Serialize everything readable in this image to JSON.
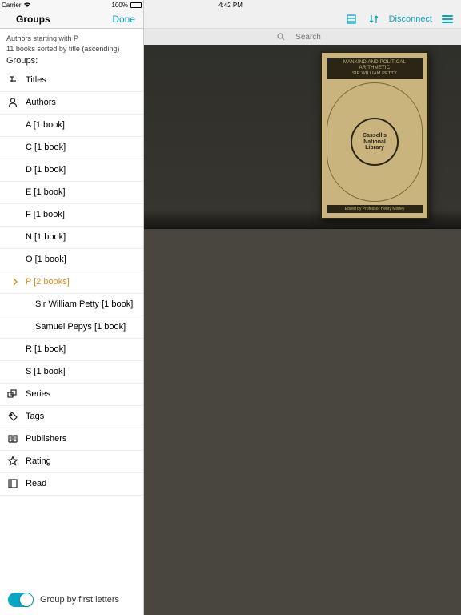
{
  "status": {
    "carrier": "Carrier",
    "time": "4:42 PM",
    "battery": "100%"
  },
  "sidebar": {
    "title": "Groups",
    "done": "Done",
    "filter_line": "Authors starting with P",
    "count_line": "11 books sorted by title (ascending)",
    "groups_label": "Groups:",
    "sections": [
      {
        "label": "Titles",
        "icon": "titles"
      },
      {
        "label": "Authors",
        "icon": "authors"
      }
    ],
    "author_letters": [
      {
        "label": "A [1 book]"
      },
      {
        "label": "C [1 book]"
      },
      {
        "label": "D [1 book]"
      },
      {
        "label": "E [1 book]"
      },
      {
        "label": "F [1 book]"
      },
      {
        "label": "N [1 book]"
      },
      {
        "label": "O [1 book]"
      },
      {
        "label": "P [2 books]",
        "active": true
      },
      {
        "label": "R [1 book]"
      },
      {
        "label": "S [1 book]"
      }
    ],
    "expanded_authors": [
      {
        "label": "Sir William Petty [1 book]"
      },
      {
        "label": "Samuel Pepys [1 book]"
      }
    ],
    "other_sections": [
      {
        "label": "Series",
        "icon": "series"
      },
      {
        "label": "Tags",
        "icon": "tags"
      },
      {
        "label": "Publishers",
        "icon": "publishers"
      },
      {
        "label": "Rating",
        "icon": "rating"
      },
      {
        "label": "Read",
        "icon": "read"
      }
    ],
    "footer_toggle": "Group by first letters"
  },
  "header": {
    "disconnect": "Disconnect"
  },
  "search": {
    "placeholder": "Search"
  },
  "book": {
    "title_line1": "Mankind and Political",
    "title_line2": "Arithmetic",
    "author": "Sir William Petty",
    "series1": "Cassell's",
    "series2": "National",
    "series3": "Library",
    "editor": "Edited by Professor Henry Morley"
  }
}
